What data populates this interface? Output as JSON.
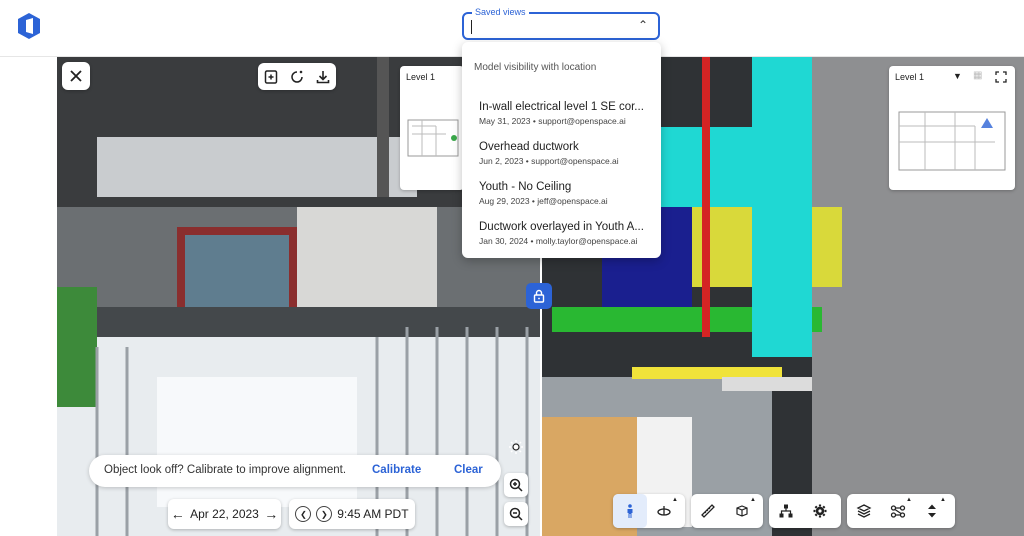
{
  "app": {
    "logo_icon": "openspace-logo-icon",
    "brand_color": "#2c63d6"
  },
  "saved_views": {
    "label": "Saved views",
    "value": "",
    "header": "Model visibility with location",
    "items": [
      {
        "title": "In-wall electrical level 1 SE cor...",
        "meta": "May 31, 2023 • support@openspace.ai"
      },
      {
        "title": "Overhead ductwork",
        "meta": "Jun 2, 2023 • support@openspace.ai"
      },
      {
        "title": "Youth - No Ceiling",
        "meta": "Aug 29, 2023 • jeff@openspace.ai"
      },
      {
        "title": "Ductwork overlayed in Youth A...",
        "meta": "Jan 30, 2024 • molly.taylor@openspace.ai"
      }
    ]
  },
  "left_viewer": {
    "minimap_title": "Level 1",
    "calibrate_prompt": "Object look off? Calibrate to improve alignment.",
    "calibrate_label": "Calibrate",
    "clear_label": "Clear",
    "date": "Apr 22, 2023",
    "time": "9:45 AM PDT"
  },
  "right_viewer": {
    "minimap_title": "Level 1"
  },
  "icons": {
    "close": "close-icon",
    "add_note": "add-note-icon",
    "compare": "compare-icon",
    "download": "download-icon",
    "lock": "lock-icon",
    "brightness": "brightness-icon",
    "zoom_in": "zoom-in-icon",
    "zoom_out": "zoom-out-icon",
    "person": "person-icon",
    "orbit": "orbit-icon",
    "measure": "measure-icon",
    "section_box": "section-box-icon",
    "hierarchy": "hierarchy-icon",
    "settings": "gear-icon",
    "layers": "layers-icon",
    "nodes": "nodes-icon",
    "elevation": "elevation-icon",
    "fullscreen": "fullscreen-icon"
  }
}
